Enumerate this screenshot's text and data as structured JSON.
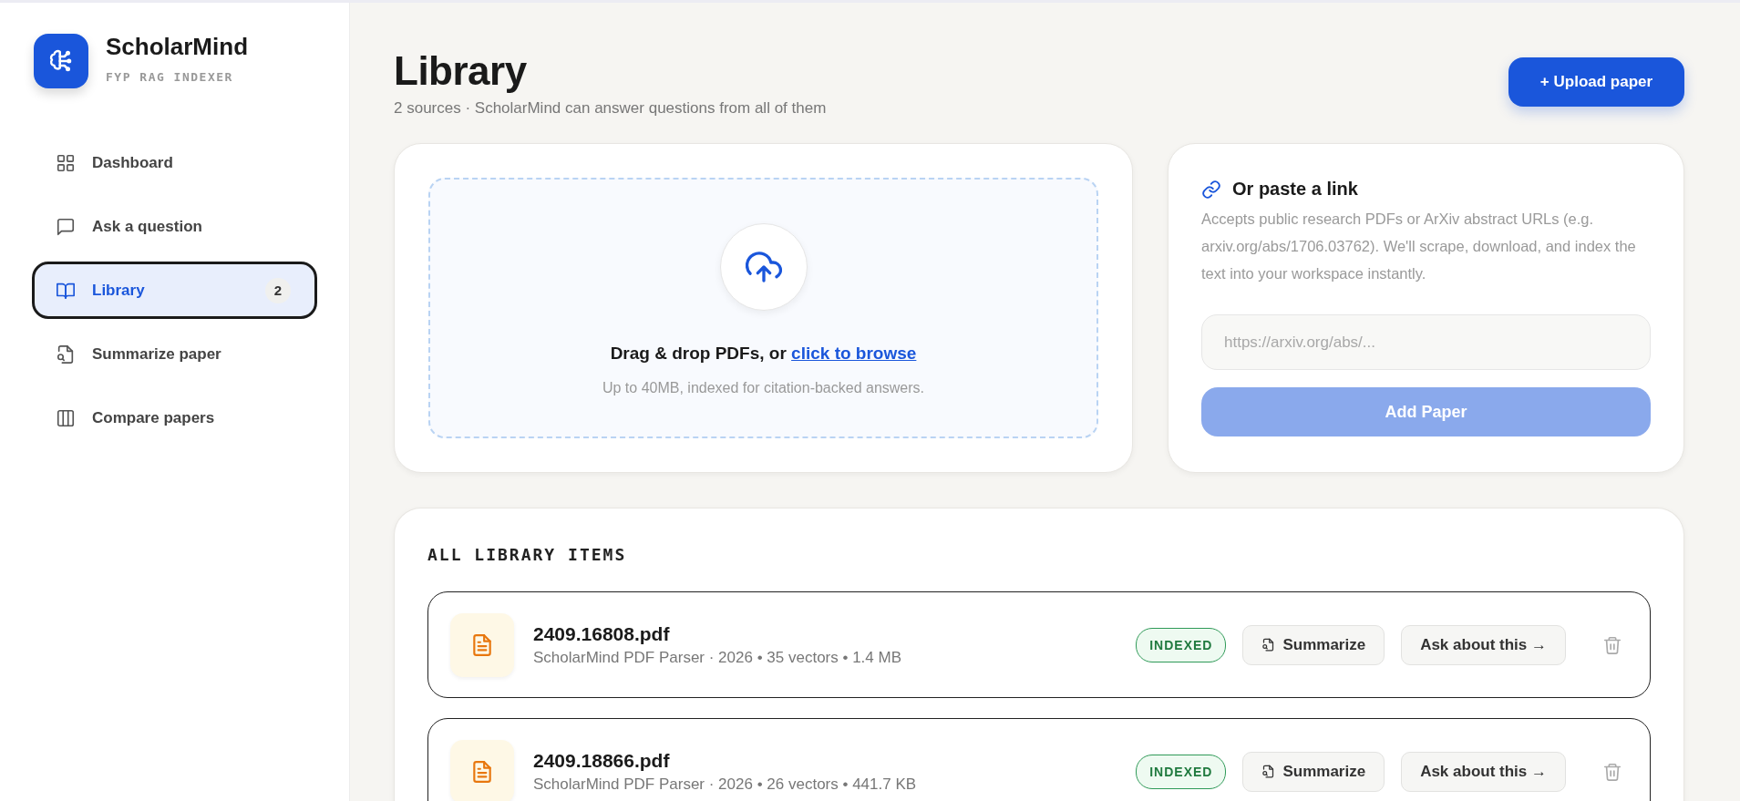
{
  "brand": {
    "name": "ScholarMind",
    "tagline": "FYP RAG INDEXER"
  },
  "nav": [
    {
      "label": "Dashboard",
      "selected": false
    },
    {
      "label": "Ask a question",
      "selected": false
    },
    {
      "label": "Library",
      "selected": true,
      "badge": "2"
    },
    {
      "label": "Summarize paper",
      "selected": false
    },
    {
      "label": "Compare papers",
      "selected": false
    }
  ],
  "header": {
    "title": "Library",
    "subtitle": "2 sources · ScholarMind can answer questions from all of them",
    "upload_button": "+ Upload paper"
  },
  "dropzone": {
    "text": "Drag & drop PDFs, or ",
    "link": "click to browse",
    "hint": "Up to 40MB, indexed for citation-backed answers."
  },
  "link_card": {
    "title": "Or paste a link",
    "description": "Accepts public research PDFs or ArXiv abstract URLs (e.g. arxiv.org/abs/1706.03762). We'll scrape, download, and index the text into your workspace instantly.",
    "placeholder": "https://arxiv.org/abs/...",
    "button": "Add Paper",
    "disabled": true
  },
  "library": {
    "heading": "ALL LIBRARY ITEMS",
    "items": [
      {
        "name": "2409.16808.pdf",
        "meta": "ScholarMind PDF Parser · 2026 • 35 vectors • 1.4 MB",
        "status": "INDEXED",
        "summarize": "Summarize",
        "ask": "Ask about this →"
      },
      {
        "name": "2409.18866.pdf",
        "meta": "ScholarMind PDF Parser · 2026 • 26 vectors • 441.7 KB",
        "status": "INDEXED",
        "summarize": "Summarize",
        "ask": "Ask about this →"
      }
    ]
  }
}
